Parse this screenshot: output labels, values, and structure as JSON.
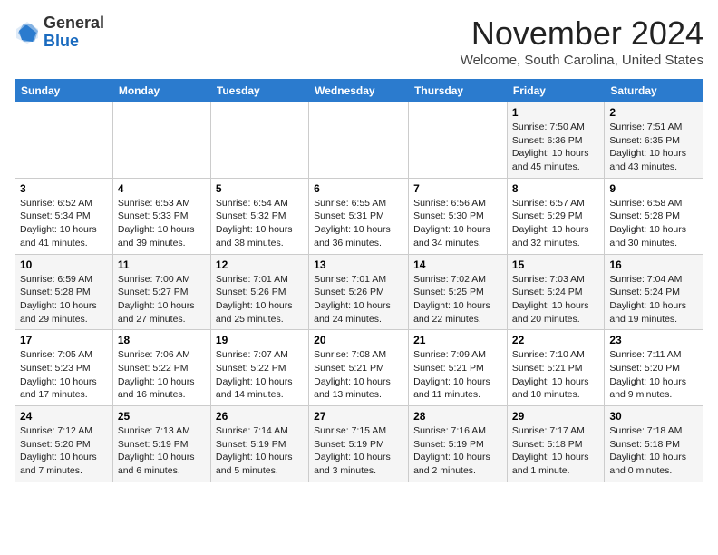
{
  "logo": {
    "general": "General",
    "blue": "Blue"
  },
  "header": {
    "month": "November 2024",
    "location": "Welcome, South Carolina, United States"
  },
  "weekdays": [
    "Sunday",
    "Monday",
    "Tuesday",
    "Wednesday",
    "Thursday",
    "Friday",
    "Saturday"
  ],
  "weeks": [
    [
      {
        "day": "",
        "info": ""
      },
      {
        "day": "",
        "info": ""
      },
      {
        "day": "",
        "info": ""
      },
      {
        "day": "",
        "info": ""
      },
      {
        "day": "",
        "info": ""
      },
      {
        "day": "1",
        "info": "Sunrise: 7:50 AM\nSunset: 6:36 PM\nDaylight: 10 hours and 45 minutes."
      },
      {
        "day": "2",
        "info": "Sunrise: 7:51 AM\nSunset: 6:35 PM\nDaylight: 10 hours and 43 minutes."
      }
    ],
    [
      {
        "day": "3",
        "info": "Sunrise: 6:52 AM\nSunset: 5:34 PM\nDaylight: 10 hours and 41 minutes."
      },
      {
        "day": "4",
        "info": "Sunrise: 6:53 AM\nSunset: 5:33 PM\nDaylight: 10 hours and 39 minutes."
      },
      {
        "day": "5",
        "info": "Sunrise: 6:54 AM\nSunset: 5:32 PM\nDaylight: 10 hours and 38 minutes."
      },
      {
        "day": "6",
        "info": "Sunrise: 6:55 AM\nSunset: 5:31 PM\nDaylight: 10 hours and 36 minutes."
      },
      {
        "day": "7",
        "info": "Sunrise: 6:56 AM\nSunset: 5:30 PM\nDaylight: 10 hours and 34 minutes."
      },
      {
        "day": "8",
        "info": "Sunrise: 6:57 AM\nSunset: 5:29 PM\nDaylight: 10 hours and 32 minutes."
      },
      {
        "day": "9",
        "info": "Sunrise: 6:58 AM\nSunset: 5:28 PM\nDaylight: 10 hours and 30 minutes."
      }
    ],
    [
      {
        "day": "10",
        "info": "Sunrise: 6:59 AM\nSunset: 5:28 PM\nDaylight: 10 hours and 29 minutes."
      },
      {
        "day": "11",
        "info": "Sunrise: 7:00 AM\nSunset: 5:27 PM\nDaylight: 10 hours and 27 minutes."
      },
      {
        "day": "12",
        "info": "Sunrise: 7:01 AM\nSunset: 5:26 PM\nDaylight: 10 hours and 25 minutes."
      },
      {
        "day": "13",
        "info": "Sunrise: 7:01 AM\nSunset: 5:26 PM\nDaylight: 10 hours and 24 minutes."
      },
      {
        "day": "14",
        "info": "Sunrise: 7:02 AM\nSunset: 5:25 PM\nDaylight: 10 hours and 22 minutes."
      },
      {
        "day": "15",
        "info": "Sunrise: 7:03 AM\nSunset: 5:24 PM\nDaylight: 10 hours and 20 minutes."
      },
      {
        "day": "16",
        "info": "Sunrise: 7:04 AM\nSunset: 5:24 PM\nDaylight: 10 hours and 19 minutes."
      }
    ],
    [
      {
        "day": "17",
        "info": "Sunrise: 7:05 AM\nSunset: 5:23 PM\nDaylight: 10 hours and 17 minutes."
      },
      {
        "day": "18",
        "info": "Sunrise: 7:06 AM\nSunset: 5:22 PM\nDaylight: 10 hours and 16 minutes."
      },
      {
        "day": "19",
        "info": "Sunrise: 7:07 AM\nSunset: 5:22 PM\nDaylight: 10 hours and 14 minutes."
      },
      {
        "day": "20",
        "info": "Sunrise: 7:08 AM\nSunset: 5:21 PM\nDaylight: 10 hours and 13 minutes."
      },
      {
        "day": "21",
        "info": "Sunrise: 7:09 AM\nSunset: 5:21 PM\nDaylight: 10 hours and 11 minutes."
      },
      {
        "day": "22",
        "info": "Sunrise: 7:10 AM\nSunset: 5:21 PM\nDaylight: 10 hours and 10 minutes."
      },
      {
        "day": "23",
        "info": "Sunrise: 7:11 AM\nSunset: 5:20 PM\nDaylight: 10 hours and 9 minutes."
      }
    ],
    [
      {
        "day": "24",
        "info": "Sunrise: 7:12 AM\nSunset: 5:20 PM\nDaylight: 10 hours and 7 minutes."
      },
      {
        "day": "25",
        "info": "Sunrise: 7:13 AM\nSunset: 5:19 PM\nDaylight: 10 hours and 6 minutes."
      },
      {
        "day": "26",
        "info": "Sunrise: 7:14 AM\nSunset: 5:19 PM\nDaylight: 10 hours and 5 minutes."
      },
      {
        "day": "27",
        "info": "Sunrise: 7:15 AM\nSunset: 5:19 PM\nDaylight: 10 hours and 3 minutes."
      },
      {
        "day": "28",
        "info": "Sunrise: 7:16 AM\nSunset: 5:19 PM\nDaylight: 10 hours and 2 minutes."
      },
      {
        "day": "29",
        "info": "Sunrise: 7:17 AM\nSunset: 5:18 PM\nDaylight: 10 hours and 1 minute."
      },
      {
        "day": "30",
        "info": "Sunrise: 7:18 AM\nSunset: 5:18 PM\nDaylight: 10 hours and 0 minutes."
      }
    ]
  ]
}
